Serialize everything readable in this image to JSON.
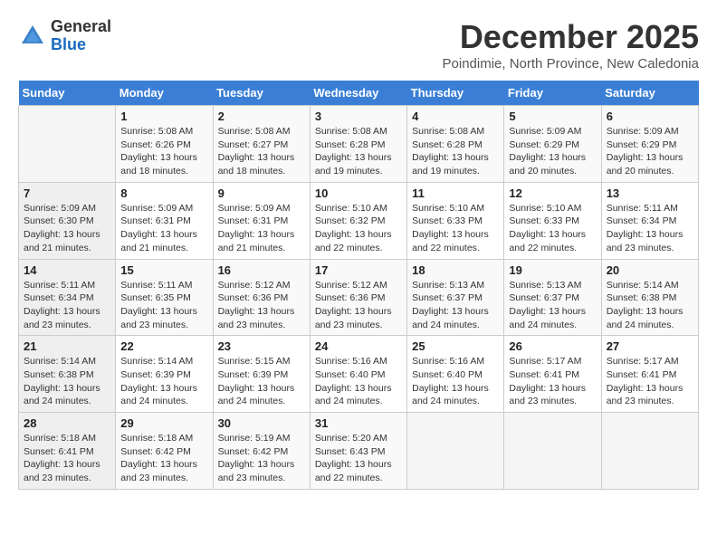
{
  "logo": {
    "line1": "General",
    "line2": "Blue"
  },
  "header": {
    "month": "December 2025",
    "location": "Poindimie, North Province, New Caledonia"
  },
  "weekdays": [
    "Sunday",
    "Monday",
    "Tuesday",
    "Wednesday",
    "Thursday",
    "Friday",
    "Saturday"
  ],
  "weeks": [
    [
      {
        "day": "",
        "info": ""
      },
      {
        "day": "1",
        "info": "Sunrise: 5:08 AM\nSunset: 6:26 PM\nDaylight: 13 hours\nand 18 minutes."
      },
      {
        "day": "2",
        "info": "Sunrise: 5:08 AM\nSunset: 6:27 PM\nDaylight: 13 hours\nand 18 minutes."
      },
      {
        "day": "3",
        "info": "Sunrise: 5:08 AM\nSunset: 6:28 PM\nDaylight: 13 hours\nand 19 minutes."
      },
      {
        "day": "4",
        "info": "Sunrise: 5:08 AM\nSunset: 6:28 PM\nDaylight: 13 hours\nand 19 minutes."
      },
      {
        "day": "5",
        "info": "Sunrise: 5:09 AM\nSunset: 6:29 PM\nDaylight: 13 hours\nand 20 minutes."
      },
      {
        "day": "6",
        "info": "Sunrise: 5:09 AM\nSunset: 6:29 PM\nDaylight: 13 hours\nand 20 minutes."
      }
    ],
    [
      {
        "day": "7",
        "info": "Sunrise: 5:09 AM\nSunset: 6:30 PM\nDaylight: 13 hours\nand 21 minutes."
      },
      {
        "day": "8",
        "info": "Sunrise: 5:09 AM\nSunset: 6:31 PM\nDaylight: 13 hours\nand 21 minutes."
      },
      {
        "day": "9",
        "info": "Sunrise: 5:09 AM\nSunset: 6:31 PM\nDaylight: 13 hours\nand 21 minutes."
      },
      {
        "day": "10",
        "info": "Sunrise: 5:10 AM\nSunset: 6:32 PM\nDaylight: 13 hours\nand 22 minutes."
      },
      {
        "day": "11",
        "info": "Sunrise: 5:10 AM\nSunset: 6:33 PM\nDaylight: 13 hours\nand 22 minutes."
      },
      {
        "day": "12",
        "info": "Sunrise: 5:10 AM\nSunset: 6:33 PM\nDaylight: 13 hours\nand 22 minutes."
      },
      {
        "day": "13",
        "info": "Sunrise: 5:11 AM\nSunset: 6:34 PM\nDaylight: 13 hours\nand 23 minutes."
      }
    ],
    [
      {
        "day": "14",
        "info": "Sunrise: 5:11 AM\nSunset: 6:34 PM\nDaylight: 13 hours\nand 23 minutes."
      },
      {
        "day": "15",
        "info": "Sunrise: 5:11 AM\nSunset: 6:35 PM\nDaylight: 13 hours\nand 23 minutes."
      },
      {
        "day": "16",
        "info": "Sunrise: 5:12 AM\nSunset: 6:36 PM\nDaylight: 13 hours\nand 23 minutes."
      },
      {
        "day": "17",
        "info": "Sunrise: 5:12 AM\nSunset: 6:36 PM\nDaylight: 13 hours\nand 23 minutes."
      },
      {
        "day": "18",
        "info": "Sunrise: 5:13 AM\nSunset: 6:37 PM\nDaylight: 13 hours\nand 24 minutes."
      },
      {
        "day": "19",
        "info": "Sunrise: 5:13 AM\nSunset: 6:37 PM\nDaylight: 13 hours\nand 24 minutes."
      },
      {
        "day": "20",
        "info": "Sunrise: 5:14 AM\nSunset: 6:38 PM\nDaylight: 13 hours\nand 24 minutes."
      }
    ],
    [
      {
        "day": "21",
        "info": "Sunrise: 5:14 AM\nSunset: 6:38 PM\nDaylight: 13 hours\nand 24 minutes."
      },
      {
        "day": "22",
        "info": "Sunrise: 5:14 AM\nSunset: 6:39 PM\nDaylight: 13 hours\nand 24 minutes."
      },
      {
        "day": "23",
        "info": "Sunrise: 5:15 AM\nSunset: 6:39 PM\nDaylight: 13 hours\nand 24 minutes."
      },
      {
        "day": "24",
        "info": "Sunrise: 5:16 AM\nSunset: 6:40 PM\nDaylight: 13 hours\nand 24 minutes."
      },
      {
        "day": "25",
        "info": "Sunrise: 5:16 AM\nSunset: 6:40 PM\nDaylight: 13 hours\nand 24 minutes."
      },
      {
        "day": "26",
        "info": "Sunrise: 5:17 AM\nSunset: 6:41 PM\nDaylight: 13 hours\nand 23 minutes."
      },
      {
        "day": "27",
        "info": "Sunrise: 5:17 AM\nSunset: 6:41 PM\nDaylight: 13 hours\nand 23 minutes."
      }
    ],
    [
      {
        "day": "28",
        "info": "Sunrise: 5:18 AM\nSunset: 6:41 PM\nDaylight: 13 hours\nand 23 minutes."
      },
      {
        "day": "29",
        "info": "Sunrise: 5:18 AM\nSunset: 6:42 PM\nDaylight: 13 hours\nand 23 minutes."
      },
      {
        "day": "30",
        "info": "Sunrise: 5:19 AM\nSunset: 6:42 PM\nDaylight: 13 hours\nand 23 minutes."
      },
      {
        "day": "31",
        "info": "Sunrise: 5:20 AM\nSunset: 6:43 PM\nDaylight: 13 hours\nand 22 minutes."
      },
      {
        "day": "",
        "info": ""
      },
      {
        "day": "",
        "info": ""
      },
      {
        "day": "",
        "info": ""
      }
    ]
  ]
}
